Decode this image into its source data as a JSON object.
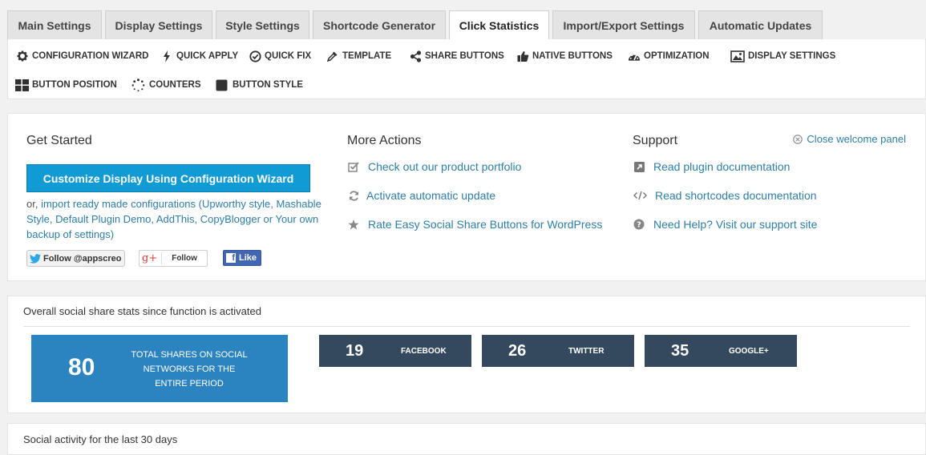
{
  "tabs": [
    "Main Settings",
    "Display Settings",
    "Style Settings",
    "Shortcode Generator",
    "Click Statistics",
    "Import/Export Settings",
    "Automatic Updates"
  ],
  "active_tab": "Click Statistics",
  "subnav": {
    "configuration_wizard": {
      "label": "CONFIGURATION WIZARD",
      "icon": "gear-icon"
    },
    "quick_apply": {
      "label": "QUICK APPLY",
      "icon": "bolt-icon"
    },
    "quick_fix": {
      "label": "QUICK FIX",
      "icon": "check-circle-icon"
    },
    "template": {
      "label": "TEMPLATE",
      "icon": "eyedropper-icon"
    },
    "share_buttons": {
      "label": "SHARE BUTTONS",
      "icon": "share-icon"
    },
    "native_buttons": {
      "label": "NATIVE BUTTONS",
      "icon": "thumbs-up-icon"
    },
    "optimization": {
      "label": "OPTIMIZATION",
      "icon": "dashboard-icon"
    },
    "display_settings": {
      "label": "DISPLAY SETTINGS",
      "icon": "image-icon"
    },
    "button_position": {
      "label": "BUTTON POSITION",
      "icon": "grid-icon"
    },
    "counters": {
      "label": "COUNTERS",
      "icon": "spinner-icon"
    },
    "button_style": {
      "label": "BUTTON STYLE",
      "icon": "square-icon"
    }
  },
  "welcome": {
    "get_started_title": "Get Started",
    "wizard_button": "Customize Display Using Configuration Wizard",
    "or_prefix": "or,",
    "import_link": "import ready made configurations (Upworthy style, Mashable Style, Default Plugin Demo, AddThis, CopyBlogger or Your own backup of settings)",
    "twitter_follow": "Follow @appscreo",
    "gplus_follow": "Follow",
    "gplus_icon": "g+",
    "fb_like": "Like",
    "more_actions_title": "More Actions",
    "actions": [
      {
        "label": "Check out our product portfolio",
        "icon": "checkbox-icon"
      },
      {
        "label": "Activate automatic update",
        "icon": "refresh-icon"
      },
      {
        "label": "Rate Easy Social Share Buttons for WordPress",
        "icon": "star-icon"
      }
    ],
    "support_title": "Support",
    "support": [
      {
        "label": "Read plugin documentation",
        "icon": "external-link-icon"
      },
      {
        "label": "Read shortcodes documentation",
        "icon": "code-icon"
      },
      {
        "label": "Need Help? Visit our support site",
        "icon": "question-circle-icon"
      }
    ],
    "close_label": "Close welcome panel"
  },
  "stats": {
    "title": "Overall social share stats since function is activated",
    "total_value": "80",
    "total_label_line1": "TOTAL SHARES ON SOCIAL",
    "total_label_line2": "NETWORKS FOR THE",
    "total_label_line3": "ENTIRE PERIOD",
    "networks": [
      {
        "value": "19",
        "label": "FACEBOOK"
      },
      {
        "value": "26",
        "label": "TWITTER"
      },
      {
        "value": "35",
        "label": "GOOGLE+"
      }
    ]
  },
  "activity": {
    "title": "Social activity for the last 30 days"
  },
  "colors": {
    "accent_blue": "#119bd4",
    "stat_blue": "#2b83bf",
    "network_dark": "#34495e",
    "link": "#2e7ea6"
  }
}
